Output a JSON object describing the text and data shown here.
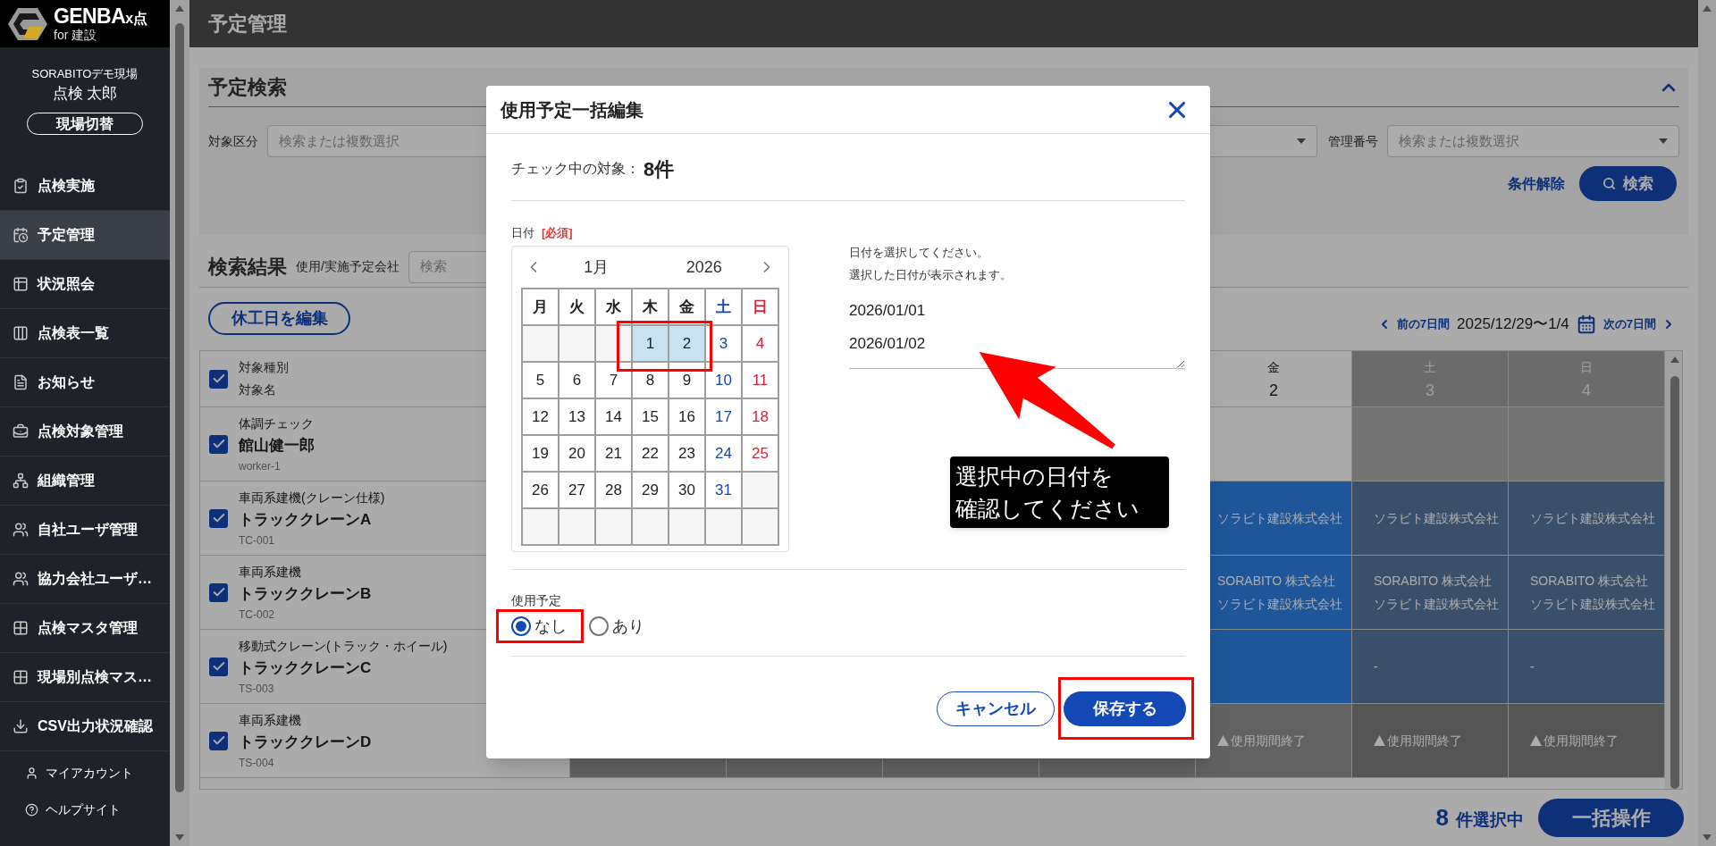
{
  "sidebar": {
    "logo": {
      "title": "GENBA",
      "suffix": "x点",
      "subtitle": "for 建設"
    },
    "site": "SORABITOデモ現場",
    "user": "点検 太郎",
    "switch_button": "現場切替",
    "items": [
      {
        "label": "点検実施",
        "selected": false
      },
      {
        "label": "予定管理",
        "selected": true
      },
      {
        "label": "状況照会",
        "selected": false
      },
      {
        "label": "点検表一覧",
        "selected": false
      },
      {
        "label": "お知らせ",
        "selected": false
      },
      {
        "label": "点検対象管理",
        "selected": false
      },
      {
        "label": "組織管理",
        "selected": false
      },
      {
        "label": "自社ユーザ管理",
        "selected": false
      },
      {
        "label": "協力会社ユーザ…",
        "selected": false
      },
      {
        "label": "点検マスタ管理",
        "selected": false
      },
      {
        "label": "現場別点検マス…",
        "selected": false
      },
      {
        "label": "CSV出力状況確認",
        "selected": false
      }
    ],
    "footer_links": [
      "マイアカウント",
      "ヘルプサイト"
    ]
  },
  "header": {
    "title": "予定管理"
  },
  "search": {
    "title": "予定検索",
    "filters": [
      {
        "kind": "select",
        "label": "対象区分",
        "placeholder": "検索または複数選択"
      },
      {
        "kind": "select"
      },
      {
        "kind": "select",
        "label": "管理番号",
        "placeholder": "検索または複数選択"
      }
    ],
    "clear_link": "条件解除",
    "search_button": "検索"
  },
  "results": {
    "title": "検索結果",
    "company_label": "使用/実施予定会社",
    "company_placeholder": "検索",
    "holiday_button": "休工日を編集",
    "nav": {
      "prev": "前の7日間",
      "range": "2025/12/29〜1/4",
      "next": "次の7日間"
    },
    "table": {
      "header": {
        "checked": true,
        "type_label": "対象種別",
        "name_label": "対象名"
      },
      "columns": [
        {
          "weekday": "金",
          "day": "2",
          "holiday": false
        },
        {
          "weekday": "土",
          "day": "3",
          "holiday": true
        },
        {
          "weekday": "日",
          "day": "4",
          "holiday": true
        }
      ],
      "rows": [
        {
          "checked": true,
          "type": "体調チェック",
          "name": "館山健一郎",
          "code": "worker-1",
          "cells": [
            {
              "kind": "none"
            },
            {
              "kind": "none"
            },
            {
              "kind": "none"
            }
          ]
        },
        {
          "checked": true,
          "type": "車両系建機(クレーン仕様)",
          "name": "トラッククレーンA",
          "code": "TC-001",
          "cells": [
            {
              "kind": "planned",
              "lines": [
                "ソラビト建設株式会社"
              ]
            },
            {
              "kind": "planned",
              "lines": [
                "ソラビト建設株式会社"
              ]
            },
            {
              "kind": "planned",
              "lines": [
                "ソラビト建設株式会社"
              ]
            }
          ]
        },
        {
          "checked": true,
          "type": "車両系建機",
          "name": "トラッククレーンB",
          "code": "TC-002",
          "cells": [
            {
              "kind": "planned",
              "lines": [
                "SORABITO 株式会社",
                "ソラビト建設株式会社"
              ]
            },
            {
              "kind": "planned",
              "lines": [
                "SORABITO 株式会社",
                "ソラビト建設株式会社"
              ]
            },
            {
              "kind": "planned",
              "lines": [
                "SORABITO 株式会社",
                "ソラビト建設株式会社"
              ]
            }
          ]
        },
        {
          "checked": true,
          "type": "移動式クレーン(トラック・ホイール)",
          "name": "トラッククレーンC",
          "code": "TS-003",
          "cells": [
            {
              "kind": "planned"
            },
            {
              "kind": "planned",
              "lines": [
                "-"
              ]
            },
            {
              "kind": "planned",
              "lines": [
                "-"
              ]
            }
          ]
        },
        {
          "checked": true,
          "type": "車両系建機",
          "name": "トラッククレーンD",
          "code": "TS-004",
          "cells": [
            {
              "kind": "expired",
              "text": "使用期間終了"
            },
            {
              "kind": "expired",
              "text": "使用期間終了"
            },
            {
              "kind": "expired",
              "text": "使用期間終了"
            }
          ]
        }
      ]
    },
    "selection": {
      "count": "8",
      "label": "件選択中"
    },
    "bulk_button": "一括操作"
  },
  "modal": {
    "title": "使用予定一括編集",
    "count_label": "チェック中の対象：",
    "count_value": "8件",
    "date_label": "日付",
    "required": "[必須]",
    "calendar": {
      "month": "1月",
      "year": "2026",
      "weekdays": [
        {
          "label": "月",
          "kind": "weekday"
        },
        {
          "label": "火",
          "kind": "weekday"
        },
        {
          "label": "水",
          "kind": "weekday"
        },
        {
          "label": "木",
          "kind": "weekday"
        },
        {
          "label": "金",
          "kind": "weekday"
        },
        {
          "label": "土",
          "kind": "saturday"
        },
        {
          "label": "日",
          "kind": "sunday"
        }
      ],
      "weeks": [
        [
          {
            "kind": "blank"
          },
          {
            "kind": "blank"
          },
          {
            "kind": "blank"
          },
          {
            "kind": "day",
            "day": "1",
            "selected": true
          },
          {
            "kind": "day",
            "day": "2",
            "selected": true
          },
          {
            "kind": "day",
            "day": "3",
            "selected": false
          },
          {
            "kind": "day",
            "day": "4",
            "selected": false
          }
        ],
        [
          {
            "kind": "day",
            "day": "5",
            "selected": false
          },
          {
            "kind": "day",
            "day": "6",
            "selected": false
          },
          {
            "kind": "day",
            "day": "7",
            "selected": false
          },
          {
            "kind": "day",
            "day": "8",
            "selected": false
          },
          {
            "kind": "day",
            "day": "9",
            "selected": false
          },
          {
            "kind": "day",
            "day": "10",
            "selected": false
          },
          {
            "kind": "day",
            "day": "11",
            "selected": false
          }
        ],
        [
          {
            "kind": "day",
            "day": "12",
            "selected": false
          },
          {
            "kind": "day",
            "day": "13",
            "selected": false
          },
          {
            "kind": "day",
            "day": "14",
            "selected": false
          },
          {
            "kind": "day",
            "day": "15",
            "selected": false
          },
          {
            "kind": "day",
            "day": "16",
            "selected": false
          },
          {
            "kind": "day",
            "day": "17",
            "selected": false
          },
          {
            "kind": "day",
            "day": "18",
            "selected": false
          }
        ],
        [
          {
            "kind": "day",
            "day": "19",
            "selected": false
          },
          {
            "kind": "day",
            "day": "20",
            "selected": false
          },
          {
            "kind": "day",
            "day": "21",
            "selected": false
          },
          {
            "kind": "day",
            "day": "22",
            "selected": false
          },
          {
            "kind": "day",
            "day": "23",
            "selected": false
          },
          {
            "kind": "day",
            "day": "24",
            "selected": false
          },
          {
            "kind": "day",
            "day": "25",
            "selected": false
          }
        ],
        [
          {
            "kind": "day",
            "day": "26",
            "selected": false
          },
          {
            "kind": "day",
            "day": "27",
            "selected": false
          },
          {
            "kind": "day",
            "day": "28",
            "selected": false
          },
          {
            "kind": "day",
            "day": "29",
            "selected": false
          },
          {
            "kind": "day",
            "day": "30",
            "selected": false
          },
          {
            "kind": "day",
            "day": "31",
            "selected": false
          },
          {
            "kind": "blank"
          }
        ],
        [
          {
            "kind": "blank"
          },
          {
            "kind": "blank"
          },
          {
            "kind": "blank"
          },
          {
            "kind": "blank"
          },
          {
            "kind": "blank"
          },
          {
            "kind": "blank"
          },
          {
            "kind": "blank"
          }
        ]
      ]
    },
    "hint": [
      "日付を選択してください。",
      "選択した日付が表示されます。"
    ],
    "selected_dates": [
      "2026/01/01",
      "2026/01/02"
    ],
    "usage_label": "使用予定",
    "options": [
      {
        "label": "なし",
        "selected": true
      },
      {
        "label": "あり",
        "selected": false
      }
    ],
    "cancel_button": "キャンセル",
    "save_button": "保存する",
    "callout": [
      "選択中の日付を",
      "確認してください"
    ]
  }
}
